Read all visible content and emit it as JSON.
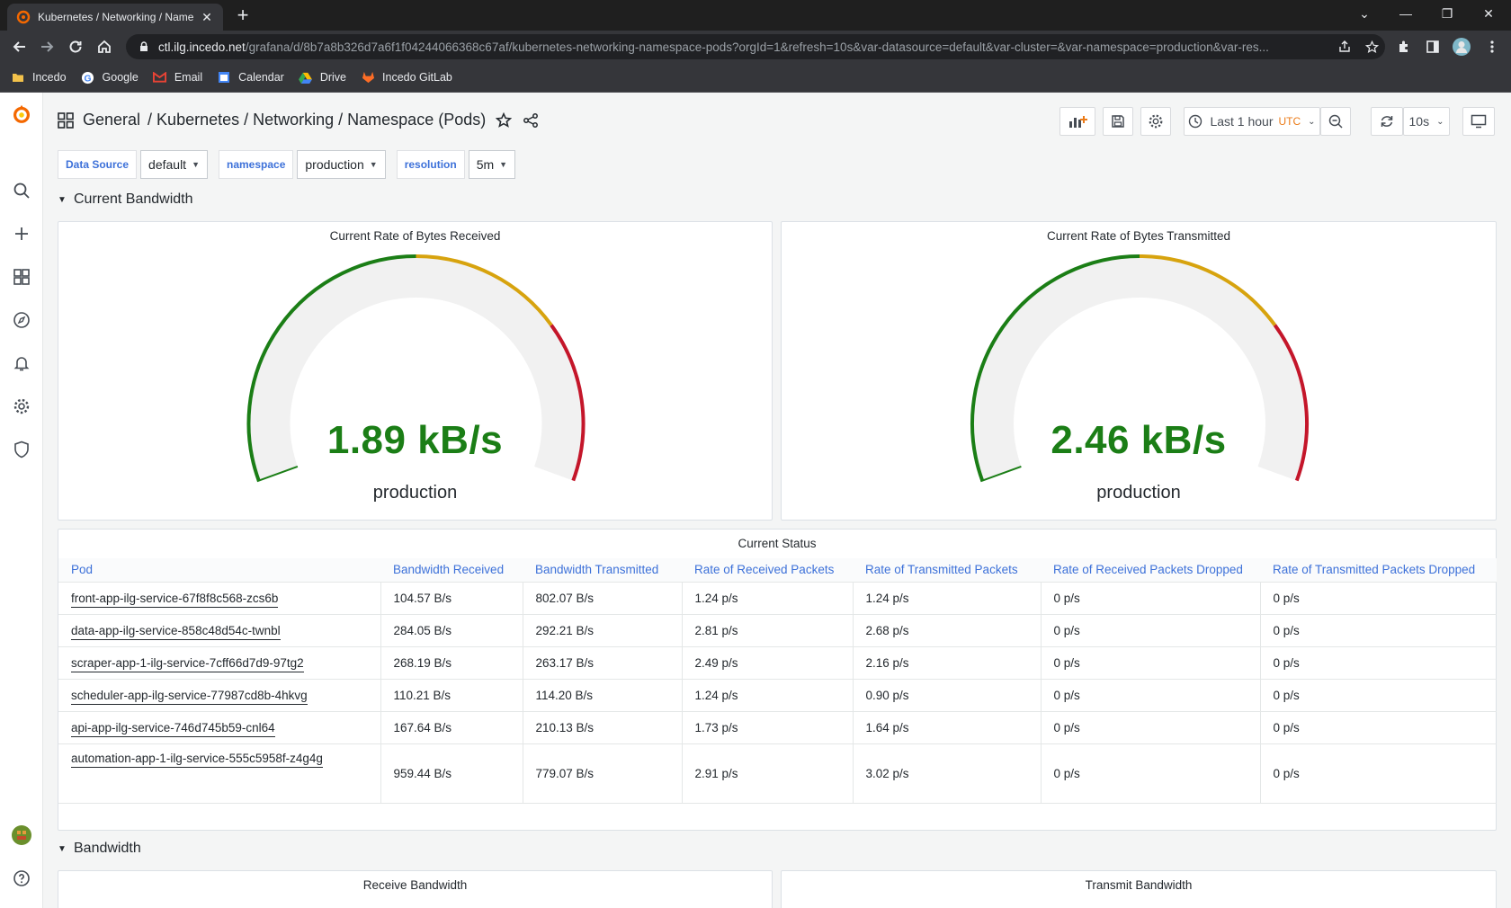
{
  "browser": {
    "tab_title": "Kubernetes / Networking / Name",
    "url_host": "ctl.ilg.incedo.net",
    "url_path": "/grafana/d/8b7a8b326d7a6f1f04244066368c67af/kubernetes-networking-namespace-pods?orgId=1&refresh=10s&var-datasource=default&var-cluster=&var-namespace=production&var-res...",
    "bookmarks": [
      "Incedo",
      "Google",
      "Email",
      "Calendar",
      "Drive",
      "Incedo GitLab"
    ]
  },
  "header": {
    "breadcrumb_folder": "General",
    "breadcrumb_title": "/ Kubernetes / Networking / Namespace (Pods)",
    "time_range": "Last 1 hour",
    "timezone": "UTC",
    "refresh_interval": "10s"
  },
  "variables": [
    {
      "label": "Data Source",
      "value": "default"
    },
    {
      "label": "namespace",
      "value": "production"
    },
    {
      "label": "resolution",
      "value": "5m"
    }
  ],
  "rows": {
    "current_bandwidth": "Current Bandwidth",
    "bandwidth": "Bandwidth"
  },
  "gauges": [
    {
      "title": "Current Rate of Bytes Received",
      "value": "1.89 kB/s",
      "label": "production",
      "fraction": 0.0
    },
    {
      "title": "Current Rate of Bytes Transmitted",
      "value": "2.46 kB/s",
      "label": "production",
      "fraction": 0.0
    }
  ],
  "colors": {
    "green": "#1b7e16",
    "yellow": "#d7a30e",
    "red": "#c4162a",
    "link_blue": "#3d71d9",
    "utc_orange": "#eb7b18"
  },
  "status_table": {
    "title": "Current Status",
    "columns": [
      "Pod",
      "Bandwidth Received",
      "Bandwidth Transmitted",
      "Rate of Received Packets",
      "Rate of Transmitted Packets",
      "Rate of Received Packets Dropped",
      "Rate of Transmitted Packets Dropped"
    ],
    "rows": [
      [
        "front-app-ilg-service-67f8f8c568-zcs6b",
        "104.57 B/s",
        "802.07 B/s",
        "1.24 p/s",
        "1.24 p/s",
        "0 p/s",
        "0 p/s"
      ],
      [
        "data-app-ilg-service-858c48d54c-twnbl",
        "284.05 B/s",
        "292.21 B/s",
        "2.81 p/s",
        "2.68 p/s",
        "0 p/s",
        "0 p/s"
      ],
      [
        "scraper-app-1-ilg-service-7cff66d7d9-97tg2",
        "268.19 B/s",
        "263.17 B/s",
        "2.49 p/s",
        "2.16 p/s",
        "0 p/s",
        "0 p/s"
      ],
      [
        "scheduler-app-ilg-service-77987cd8b-4hkvg",
        "110.21 B/s",
        "114.20 B/s",
        "1.24 p/s",
        "0.90 p/s",
        "0 p/s",
        "0 p/s"
      ],
      [
        "api-app-ilg-service-746d745b59-cnl64",
        "167.64 B/s",
        "210.13 B/s",
        "1.73 p/s",
        "1.64 p/s",
        "0 p/s",
        "0 p/s"
      ],
      [
        "automation-app-1-ilg-service-555c5958f-z4g4g",
        "959.44 B/s",
        "779.07 B/s",
        "2.91 p/s",
        "3.02 p/s",
        "0 p/s",
        "0 p/s"
      ]
    ]
  },
  "bottom_panels": [
    "Receive Bandwidth",
    "Transmit Bandwidth"
  ]
}
